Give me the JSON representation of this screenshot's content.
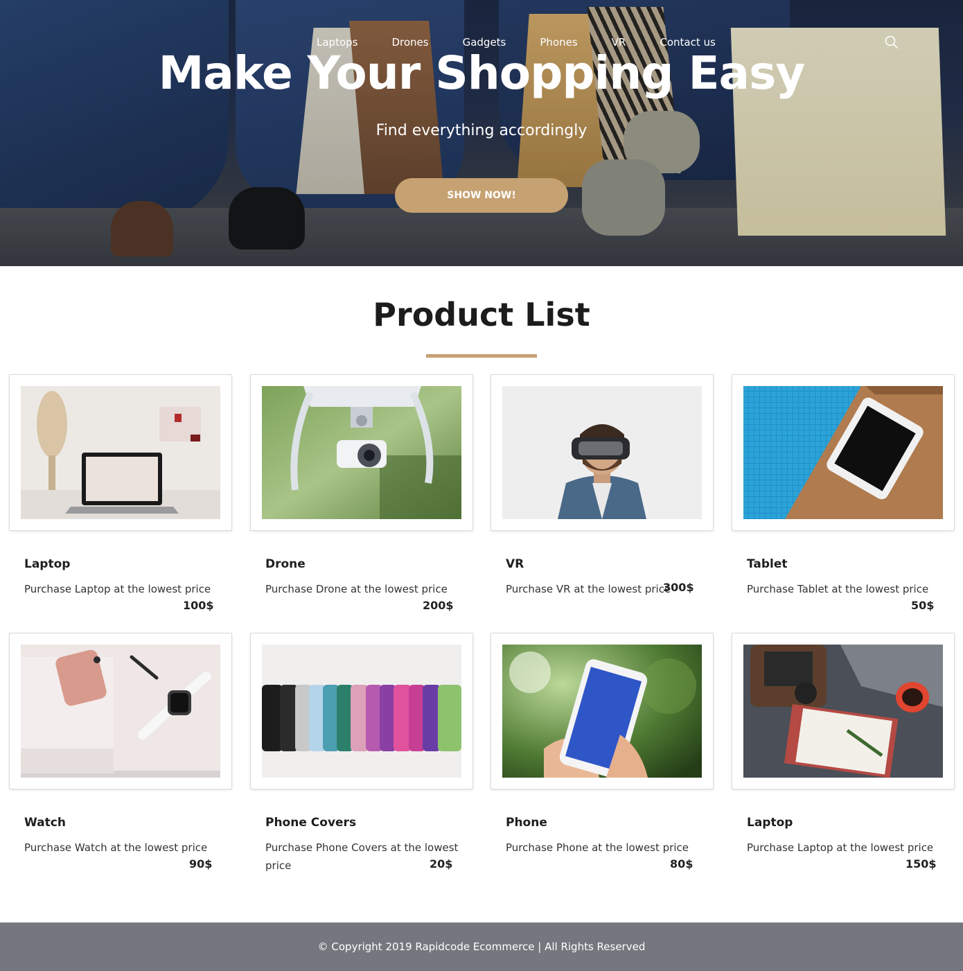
{
  "nav": {
    "items": [
      {
        "label": "Laptops"
      },
      {
        "label": "Drones"
      },
      {
        "label": "Gadgets"
      },
      {
        "label": "Phones"
      },
      {
        "label": "VR"
      },
      {
        "label": "Contact us"
      }
    ],
    "search_icon": "search-icon"
  },
  "hero": {
    "title": "Make Your Shopping Easy",
    "subtitle": "Find everything accordingly",
    "button_label": "SHOW NOW!"
  },
  "products_section": {
    "title": "Product List",
    "items": [
      {
        "name": "Laptop",
        "description": "Purchase Laptop at the lowest price",
        "price": "100$",
        "image": "laptop-photo"
      },
      {
        "name": "Drone",
        "description": "Purchase Drone at the lowest price",
        "price": "200$",
        "image": "drone-photo"
      },
      {
        "name": "VR",
        "description": "Purchase VR at the lowest price",
        "price": "300$",
        "image": "vr-headset-photo"
      },
      {
        "name": "Tablet",
        "description": "Purchase Tablet at the lowest price",
        "price": "50$",
        "image": "tablet-photo"
      },
      {
        "name": "Watch",
        "description": "Purchase Watch at the lowest price",
        "price": "90$",
        "image": "watch-photo"
      },
      {
        "name": "Phone Covers",
        "description": "Purchase Phone Covers at the lowest price",
        "price": "20$",
        "image": "phone-covers-photo"
      },
      {
        "name": "Phone",
        "description": "Purchase Phone at the lowest price",
        "price": "80$",
        "image": "phone-photo"
      },
      {
        "name": "Laptop",
        "description": "Purchase Laptop at the lowest price",
        "price": "150$",
        "image": "laptop-desk-photo"
      }
    ]
  },
  "footer": {
    "text": "© Copyright 2019 Rapidcode Ecommerce | All Rights Reserved"
  },
  "colors": {
    "accent": "#c6a172",
    "footer_bg": "#75777f",
    "title_text": "#1c1c1c"
  }
}
